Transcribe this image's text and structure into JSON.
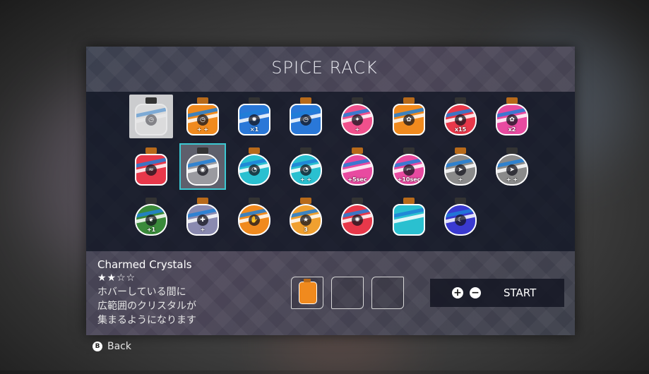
{
  "screen": {
    "title": "SPICE RACK"
  },
  "selected": {
    "name": "Charmed Crystals",
    "stars": "★★☆☆",
    "desc_line1": "ホバーしている間に",
    "desc_line2": "広範囲のクリスタルが",
    "desc_line3": "集まるようになります"
  },
  "controls": {
    "plus_icon": "+",
    "minus_icon": "−",
    "start_label": "START",
    "back_button_icon": "B",
    "back_label": "Back"
  },
  "spices": {
    "row1": [
      {
        "icon": "clock-icon",
        "tag": "",
        "emb": "◷",
        "color": "#e8e8e8"
      },
      {
        "icon": "clock-icon",
        "tag": "+ +",
        "emb": "◷",
        "color": "#f08a1e"
      },
      {
        "icon": "gear-icon",
        "tag": "×1",
        "emb": "✹",
        "color": "#2a78d8"
      },
      {
        "icon": "clock-icon",
        "tag": "",
        "emb": "◷",
        "color": "#2a78d8"
      },
      {
        "icon": "sparkle-icon",
        "tag": "+",
        "emb": "✦",
        "color": "#f0508c"
      },
      {
        "icon": "flower-icon",
        "tag": "",
        "emb": "✿",
        "color": "#f08a1e"
      },
      {
        "icon": "gear-icon",
        "tag": "x15",
        "emb": "✹",
        "color": "#e8384a"
      },
      {
        "icon": "flower-icon",
        "tag": "x2",
        "emb": "✿",
        "color": "#e84aa0"
      }
    ],
    "row2": [
      {
        "icon": "wing-icon",
        "tag": "",
        "emb": "≈",
        "color": "#e8384a"
      },
      {
        "icon": "bolt-icon",
        "tag": "",
        "emb": "◉",
        "color": "#9a9aa0"
      },
      {
        "icon": "speed-icon",
        "tag": "",
        "emb": "◔",
        "color": "#2ac0d0"
      },
      {
        "icon": "speed-icon",
        "tag": "+ +",
        "emb": "◔",
        "color": "#2ac0d0"
      },
      {
        "icon": "wave-icon",
        "tag": "+5sec",
        "emb": "",
        "color": "#e84aa0"
      },
      {
        "icon": "hook-icon",
        "tag": "+10sec",
        "emb": "⌐",
        "color": "#e84aa0"
      },
      {
        "icon": "fish-icon",
        "tag": "+",
        "emb": "➤",
        "color": "#8a8a8a"
      },
      {
        "icon": "fish-icon",
        "tag": "+ +",
        "emb": "➤",
        "color": "#8a8a8a"
      }
    ],
    "row3": [
      {
        "icon": "leaf-icon",
        "tag": "+1",
        "emb": "❦",
        "color": "#3a8a3a"
      },
      {
        "icon": "shield-icon",
        "tag": "+",
        "emb": "✚",
        "color": "#8a8ab0"
      },
      {
        "icon": "hand-icon",
        "tag": "",
        "emb": "✋",
        "color": "#f08a1e"
      },
      {
        "icon": "star-icon",
        "tag": "3",
        "emb": "★",
        "color": "#f0a030"
      },
      {
        "icon": "burst-icon",
        "tag": "",
        "emb": "✺",
        "color": "#e8384a"
      },
      {
        "icon": "wave-icon",
        "tag": "",
        "emb": "",
        "color": "#2ac0d0"
      },
      {
        "icon": "moon-icon",
        "tag": "",
        "emb": "☾",
        "color": "#3a3ad0"
      }
    ]
  }
}
